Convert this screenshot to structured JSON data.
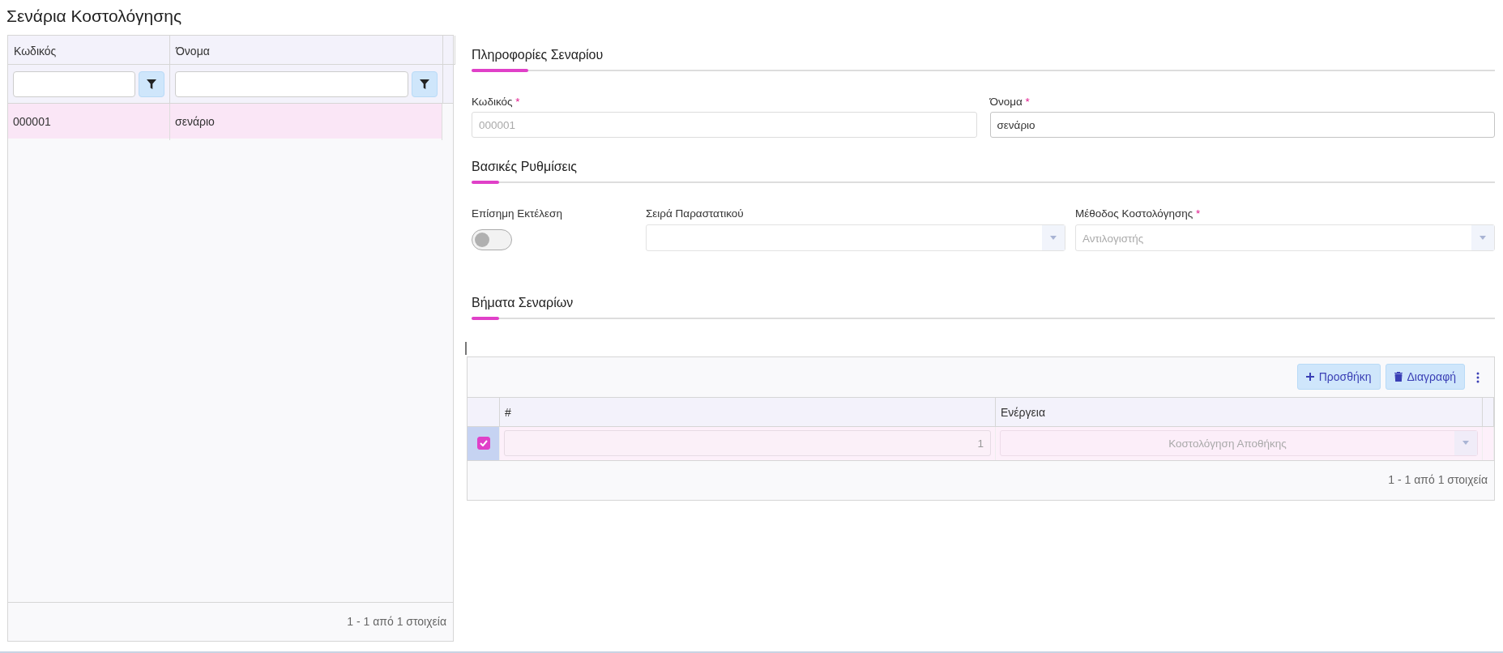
{
  "page_title": "Σενάρια Κοστολόγησης",
  "list_grid": {
    "columns": [
      {
        "label": "Κωδικός"
      },
      {
        "label": "Όνομα"
      }
    ],
    "rows": [
      {
        "cells": [
          "000001",
          "σενάριο"
        ],
        "selected": true
      }
    ],
    "pager": "1 - 1 από 1 στοιχεία"
  },
  "info_section": {
    "title": "Πληροφορίες Σεναρίου",
    "fields": [
      {
        "label": "Κωδικός",
        "required_mark": "*",
        "value": "000001",
        "disabled": true
      },
      {
        "label": "Όνομα",
        "required_mark": "*",
        "value": "σενάριο",
        "disabled": false
      }
    ]
  },
  "settings_section": {
    "title": "Βασικές Ρυθμίσεις",
    "toggle": {
      "label": "Επίσημη Εκτέλεση",
      "on": false
    },
    "selects": [
      {
        "label": "Σειρά Παραστατικού"
      },
      {
        "label": "Μέθοδος Κοστολόγησης",
        "required_mark": "*",
        "placeholder": "Αντιλογιστής"
      }
    ]
  },
  "steps_section": {
    "title": "Βήματα Σεναρίων",
    "toolbar": [
      {
        "kind": "add",
        "label": "Προσθήκη"
      },
      {
        "kind": "delete",
        "label": "Διαγραφή"
      }
    ],
    "columns": [
      "#",
      "Ενέργεια"
    ],
    "rows": [
      {
        "checked": true,
        "number": "1",
        "action": "Κοστολόγηση Αποθήκης"
      }
    ],
    "pager": "1 - 1 από 1 στοιχεία"
  }
}
